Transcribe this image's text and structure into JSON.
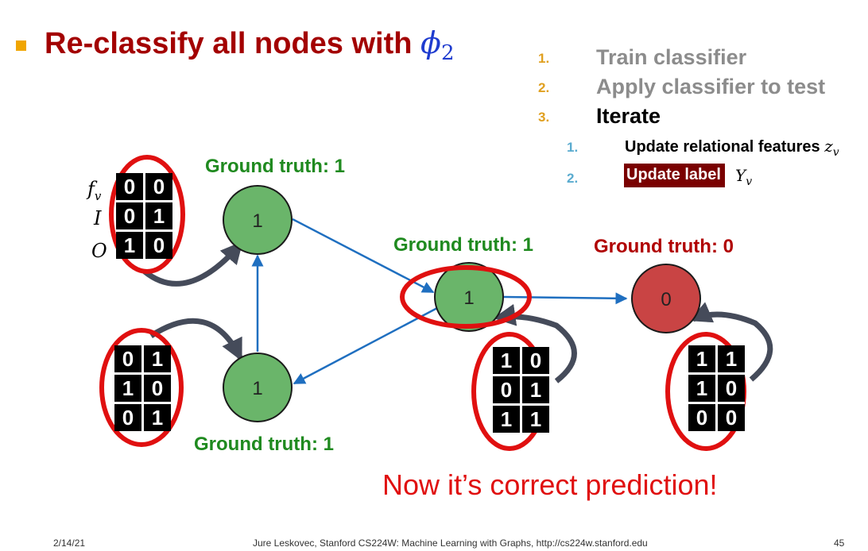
{
  "title": {
    "text": "Re-classify all nodes with ",
    "phi": "ϕ",
    "subscript": "2"
  },
  "steps": [
    {
      "num": "1.",
      "text": "Train classifier"
    },
    {
      "num": "2.",
      "text": "Apply classifier to test"
    },
    {
      "num": "3.",
      "text": "Iterate"
    }
  ],
  "substeps": [
    {
      "num": "1.",
      "text": "Update relational features",
      "math": "z",
      "math_sub": "v"
    },
    {
      "num": "2.",
      "text": "Update label",
      "math": "Y",
      "math_sub": "v"
    }
  ],
  "side_labels": {
    "f": "f",
    "f_sub": "v",
    "i": "I",
    "o": "O"
  },
  "nodes": [
    {
      "id": "top-left",
      "label": "1",
      "ground_truth": "Ground truth: 1",
      "color": "#6ab56a"
    },
    {
      "id": "bottom-left",
      "label": "1",
      "ground_truth": "Ground truth: 1",
      "color": "#6ab56a"
    },
    {
      "id": "middle",
      "label": "1",
      "ground_truth": "Ground truth: 1",
      "color": "#6ab56a"
    },
    {
      "id": "right",
      "label": "0",
      "ground_truth": "Ground truth: 0",
      "color": "#c94444"
    }
  ],
  "matrices": {
    "top_left": [
      [
        "0",
        "0"
      ],
      [
        "0",
        "1"
      ],
      [
        "1",
        "0"
      ]
    ],
    "bottom_left": [
      [
        "0",
        "1"
      ],
      [
        "1",
        "0"
      ],
      [
        "0",
        "1"
      ]
    ],
    "middle": [
      [
        "1",
        "0"
      ],
      [
        "0",
        "1"
      ],
      [
        "1",
        "1"
      ]
    ],
    "right": [
      [
        "1",
        "1"
      ],
      [
        "1",
        "0"
      ],
      [
        "0",
        "0"
      ]
    ]
  },
  "conclusion": "Now it’s correct prediction!",
  "footer": {
    "date": "2/14/21",
    "credit": "Jure Leskovec, Stanford CS224W: Machine Learning with Graphs, http://cs224w.stanford.edu",
    "page": "45"
  },
  "colors": {
    "title": "#a30000",
    "accent_orange": "#f0a500",
    "highlight_red": "#e01010",
    "edge_blue": "#1f6fc0",
    "green_text": "#1f8a1f",
    "label_box": "#7a0000"
  }
}
